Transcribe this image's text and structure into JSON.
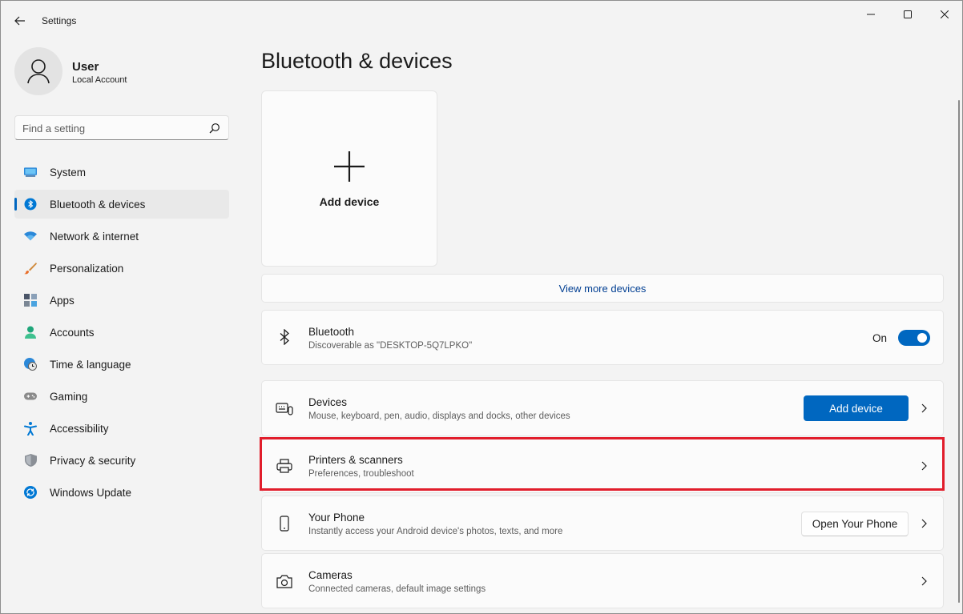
{
  "window": {
    "title": "Settings"
  },
  "profile": {
    "name": "User",
    "account": "Local Account"
  },
  "search": {
    "placeholder": "Find a setting"
  },
  "sidebar": {
    "items": [
      {
        "label": "System",
        "icon": "monitor-icon"
      },
      {
        "label": "Bluetooth & devices",
        "icon": "bluetooth-icon",
        "active": true
      },
      {
        "label": "Network & internet",
        "icon": "wifi-icon"
      },
      {
        "label": "Personalization",
        "icon": "brush-icon"
      },
      {
        "label": "Apps",
        "icon": "apps-icon"
      },
      {
        "label": "Accounts",
        "icon": "person-icon"
      },
      {
        "label": "Time & language",
        "icon": "globe-clock-icon"
      },
      {
        "label": "Gaming",
        "icon": "gamepad-icon"
      },
      {
        "label": "Accessibility",
        "icon": "accessibility-icon"
      },
      {
        "label": "Privacy & security",
        "icon": "shield-icon"
      },
      {
        "label": "Windows Update",
        "icon": "update-icon"
      }
    ]
  },
  "main": {
    "title": "Bluetooth & devices",
    "add_tile_label": "Add device",
    "view_more_label": "View more devices",
    "bluetooth": {
      "title": "Bluetooth",
      "subtitle": "Discoverable as \"DESKTOP-5Q7LPKO\"",
      "toggle_label": "On",
      "toggle_on": true
    },
    "devices": {
      "title": "Devices",
      "subtitle": "Mouse, keyboard, pen, audio, displays and docks, other devices",
      "button": "Add device"
    },
    "printers": {
      "title": "Printers & scanners",
      "subtitle": "Preferences, troubleshoot"
    },
    "phone": {
      "title": "Your Phone",
      "subtitle": "Instantly access your Android device's photos, texts, and more",
      "button": "Open Your Phone"
    },
    "cameras": {
      "title": "Cameras",
      "subtitle": "Connected cameras, default image settings"
    }
  },
  "colors": {
    "accent": "#0067c0",
    "highlight": "#e11d2b",
    "background": "#f3f3f3",
    "card": "#fbfbfb"
  }
}
